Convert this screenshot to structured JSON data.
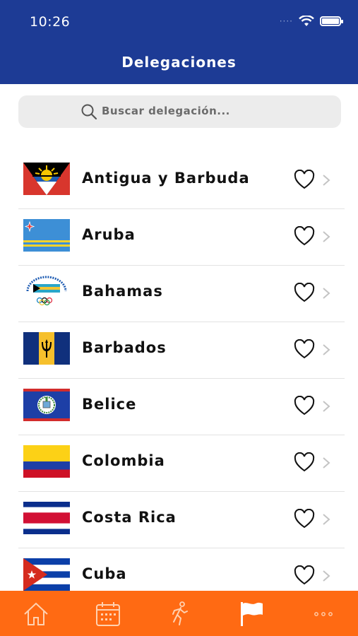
{
  "status_bar": {
    "time": "10:26"
  },
  "header": {
    "title": "Delegaciones"
  },
  "search": {
    "placeholder": "Buscar delegación..."
  },
  "countries": [
    {
      "name": "Antigua y Barbuda"
    },
    {
      "name": "Aruba"
    },
    {
      "name": "Bahamas"
    },
    {
      "name": "Barbados"
    },
    {
      "name": "Belice"
    },
    {
      "name": "Colombia"
    },
    {
      "name": "Costa Rica"
    },
    {
      "name": "Cuba"
    }
  ],
  "tabbar": {
    "items": [
      "home-icon",
      "calendar-icon",
      "runner-icon",
      "flag-icon",
      "more-icon"
    ],
    "active": "flag-icon"
  },
  "colors": {
    "header": "#1d3b95",
    "tabbar": "#ff6a13"
  }
}
